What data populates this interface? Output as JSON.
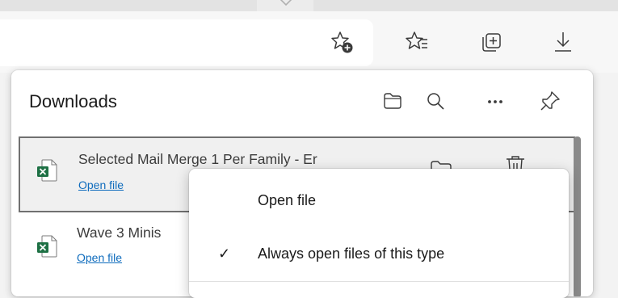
{
  "downloads": {
    "title": "Downloads",
    "items": [
      {
        "filename": "Selected Mail Merge  1 Per Family - Er",
        "action": "Open file",
        "icon": "excel-file-icon"
      },
      {
        "filename": "Wave 3 Minis",
        "action": "Open file",
        "icon": "excel-file-icon"
      }
    ]
  },
  "context_menu": {
    "items": [
      {
        "label": "Open file",
        "checked": false
      },
      {
        "label": "Always open files of this type",
        "checked": true,
        "check_glyph": "✓"
      }
    ]
  },
  "icons": {
    "toolbar": [
      "add-favorite-icon",
      "favorites-icon",
      "collections-icon",
      "downloads-icon"
    ],
    "header": [
      "folder-icon",
      "search-icon",
      "more-icon",
      "pin-icon"
    ]
  },
  "colors": {
    "link": "#0f6cbd",
    "excel": "#1d7044"
  }
}
